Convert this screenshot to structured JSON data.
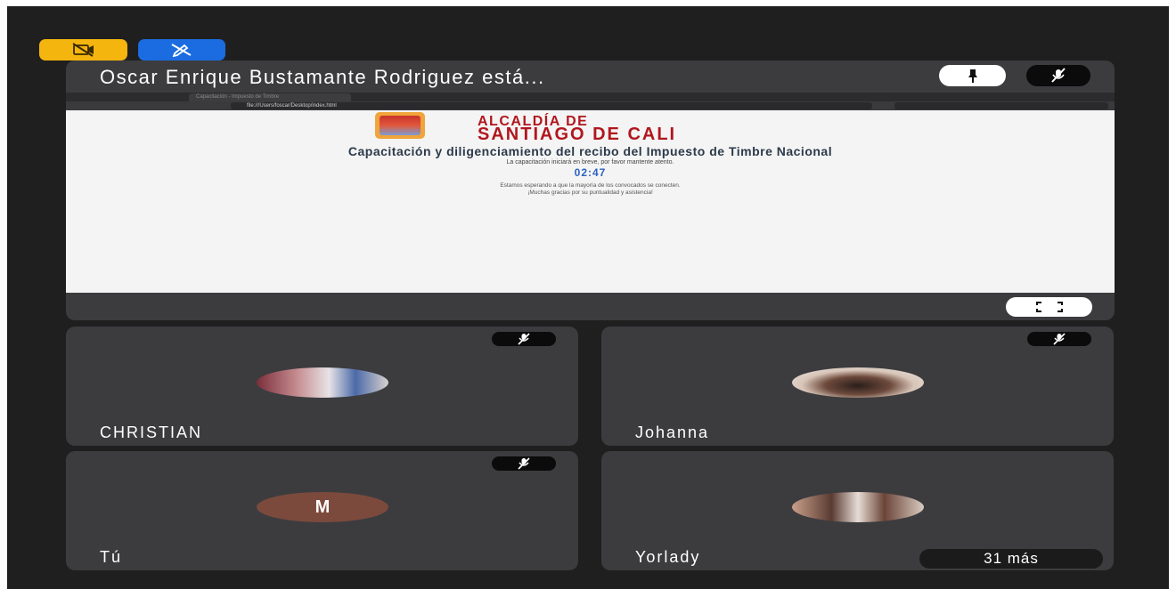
{
  "colors": {
    "background": "#1f1f1f",
    "tile": "#3c3c3f",
    "accent_yellow": "#f3b50e",
    "accent_blue": "#1a6ce0",
    "brand_red": "#b1161e",
    "countdown_blue": "#2c62c3"
  },
  "top_badges": [
    {
      "icon": "camera-off-icon"
    },
    {
      "icon": "edit-off-icon"
    }
  ],
  "presenter": {
    "name": "Oscar Enrique Bustamante Rodriguez está...",
    "pin_icon": "pin-icon",
    "mute_icon": "mic-off-icon",
    "fullscreen_icon": "fullscreen-icon"
  },
  "shared_screen": {
    "browser_tab": "Capacitación - Impuesto de Timbre",
    "url": "file:///Users/foscar/Desktop/index.html",
    "org_line1": "ALCALDÍA DE",
    "org_line2": "SANTIAGO DE CALI",
    "title": "Capacitación y diligenciamiento del recibo del Impuesto de Timbre Nacional",
    "subtitle": "La capacitación iniciará en breve, por favor mantente atento.",
    "countdown": "02:47",
    "message_line1": "Estamos esperando a que la mayoría de los convocados se conecten.",
    "message_line2": "¡Muchas gracias por su puntualidad y asistencia!"
  },
  "participants": [
    {
      "name": "CHRISTIAN",
      "muted": true,
      "avatar": "photo"
    },
    {
      "name": "Johanna",
      "muted": true,
      "avatar": "photo"
    },
    {
      "name": "Tú",
      "muted": true,
      "avatar_letter": "M"
    },
    {
      "name": "Yorlady",
      "muted": false,
      "avatar": "photo"
    }
  ],
  "more_label": "31 más"
}
